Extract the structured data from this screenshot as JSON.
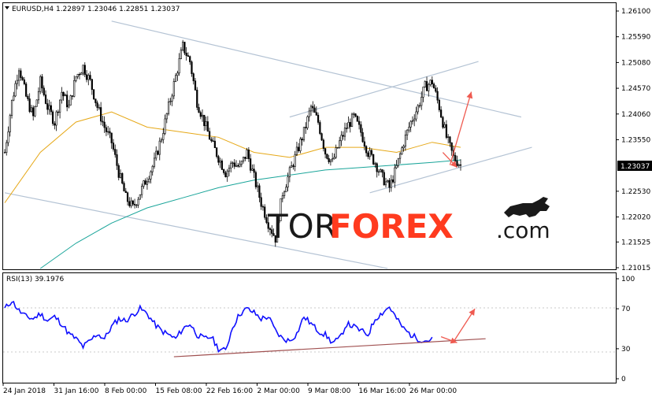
{
  "chart_data": [
    {
      "type": "candlestick",
      "header": "EURUSD,H4  1.22897 1.23046 1.22851 1.23037",
      "symbol": "EURUSD",
      "timeframe": "H4",
      "ylim": [
        1.21015,
        1.261
      ],
      "y_ticks": [
        "1.26100",
        "1.25590",
        "1.25080",
        "1.24570",
        "1.24060",
        "1.23550",
        "1.22530",
        "1.22020",
        "1.21525",
        "1.21015"
      ],
      "last_price": "1.23037",
      "x_ticks": [
        "24 Jan 2018",
        "31 Jan 16:00",
        "8 Feb 00:00",
        "15 Feb 08:00",
        "22 Feb 16:00",
        "2 Mar 00:00",
        "9 Mar 08:00",
        "16 Mar 16:00",
        "26 Mar 00:00"
      ],
      "close_path": [
        [
          0,
          1.233
        ],
        [
          4,
          1.243
        ],
        [
          8,
          1.25
        ],
        [
          12,
          1.244
        ],
        [
          16,
          1.24
        ],
        [
          20,
          1.247
        ],
        [
          24,
          1.242
        ],
        [
          28,
          1.239
        ],
        [
          32,
          1.245
        ],
        [
          36,
          1.242
        ],
        [
          40,
          1.248
        ],
        [
          44,
          1.25
        ],
        [
          48,
          1.247
        ],
        [
          52,
          1.242
        ],
        [
          56,
          1.238
        ],
        [
          60,
          1.235
        ],
        [
          64,
          1.229
        ],
        [
          68,
          1.224
        ],
        [
          72,
          1.222
        ],
        [
          76,
          1.225
        ],
        [
          80,
          1.228
        ],
        [
          84,
          1.231
        ],
        [
          88,
          1.236
        ],
        [
          92,
          1.242
        ],
        [
          96,
          1.248
        ],
        [
          100,
          1.254
        ],
        [
          104,
          1.251
        ],
        [
          108,
          1.243
        ],
        [
          112,
          1.239
        ],
        [
          116,
          1.235
        ],
        [
          120,
          1.232
        ],
        [
          124,
          1.229
        ],
        [
          128,
          1.231
        ],
        [
          132,
          1.23
        ],
        [
          136,
          1.233
        ],
        [
          140,
          1.228
        ],
        [
          144,
          1.223
        ],
        [
          148,
          1.219
        ],
        [
          152,
          1.216
        ],
        [
          156,
          1.225
        ],
        [
          160,
          1.229
        ],
        [
          164,
          1.233
        ],
        [
          168,
          1.237
        ],
        [
          172,
          1.242
        ],
        [
          176,
          1.239
        ],
        [
          180,
          1.233
        ],
        [
          184,
          1.231
        ],
        [
          188,
          1.235
        ],
        [
          192,
          1.238
        ],
        [
          196,
          1.24
        ],
        [
          200,
          1.237
        ],
        [
          204,
          1.233
        ],
        [
          208,
          1.231
        ],
        [
          212,
          1.228
        ],
        [
          216,
          1.226
        ],
        [
          220,
          1.23
        ],
        [
          224,
          1.235
        ],
        [
          228,
          1.239
        ],
        [
          232,
          1.242
        ],
        [
          236,
          1.246
        ],
        [
          240,
          1.247
        ],
        [
          244,
          1.242
        ],
        [
          248,
          1.236
        ],
        [
          252,
          1.232
        ],
        [
          256,
          1.2305
        ]
      ],
      "ma_fast_path": [
        [
          0,
          1.223
        ],
        [
          20,
          1.233
        ],
        [
          40,
          1.239
        ],
        [
          60,
          1.241
        ],
        [
          80,
          1.238
        ],
        [
          100,
          1.237
        ],
        [
          120,
          1.236
        ],
        [
          140,
          1.233
        ],
        [
          160,
          1.232
        ],
        [
          180,
          1.234
        ],
        [
          200,
          1.234
        ],
        [
          220,
          1.233
        ],
        [
          240,
          1.235
        ],
        [
          256,
          1.234
        ]
      ],
      "ma_slow_path": [
        [
          20,
          1.21
        ],
        [
          40,
          1.215
        ],
        [
          60,
          1.219
        ],
        [
          80,
          1.222
        ],
        [
          100,
          1.224
        ],
        [
          120,
          1.226
        ],
        [
          140,
          1.2275
        ],
        [
          160,
          1.2285
        ],
        [
          180,
          1.2295
        ],
        [
          200,
          1.23
        ],
        [
          220,
          1.2305
        ],
        [
          240,
          1.231
        ],
        [
          256,
          1.2315
        ]
      ],
      "channel_lines": [
        {
          "from": [
            60,
            1.259
          ],
          "to": [
            290,
            1.24
          ]
        },
        {
          "from": [
            0,
            1.225
          ],
          "to": [
            215,
            1.21
          ]
        },
        {
          "from": [
            160,
            1.24
          ],
          "to": [
            266,
            1.251
          ]
        },
        {
          "from": [
            205,
            1.225
          ],
          "to": [
            296,
            1.234
          ]
        }
      ],
      "forecast_arrow": {
        "from": [
          250,
          1.2305
        ],
        "to": [
          262,
          1.245
        ]
      },
      "touch_arrow": {
        "from": [
          246,
          1.233
        ],
        "to": [
          254,
          1.23
        ]
      },
      "colors": {
        "candles": "#000000",
        "ma_fast": "#e6a817",
        "ma_slow": "#1aa59a",
        "channel": "#b4c3d4",
        "arrow": "#ef5a50",
        "price_box": "#000000"
      }
    },
    {
      "type": "line",
      "header": "RSI(13) 39.1976",
      "indicator": "RSI(13)",
      "current_value": "39.1976",
      "ylim": [
        0,
        100
      ],
      "y_ticks": [
        "100",
        "70",
        "30",
        "0"
      ],
      "values": [
        [
          0,
          70
        ],
        [
          4,
          78
        ],
        [
          8,
          68
        ],
        [
          12,
          62
        ],
        [
          16,
          60
        ],
        [
          20,
          65
        ],
        [
          24,
          58
        ],
        [
          28,
          62
        ],
        [
          32,
          55
        ],
        [
          36,
          45
        ],
        [
          40,
          40
        ],
        [
          44,
          32
        ],
        [
          48,
          38
        ],
        [
          52,
          45
        ],
        [
          56,
          40
        ],
        [
          60,
          52
        ],
        [
          64,
          60
        ],
        [
          68,
          58
        ],
        [
          72,
          64
        ],
        [
          76,
          70
        ],
        [
          80,
          65
        ],
        [
          84,
          55
        ],
        [
          88,
          48
        ],
        [
          92,
          44
        ],
        [
          96,
          40
        ],
        [
          100,
          50
        ],
        [
          104,
          55
        ],
        [
          108,
          44
        ],
        [
          112,
          40
        ],
        [
          116,
          42
        ],
        [
          120,
          30
        ],
        [
          124,
          28
        ],
        [
          128,
          52
        ],
        [
          132,
          65
        ],
        [
          136,
          70
        ],
        [
          140,
          66
        ],
        [
          144,
          60
        ],
        [
          148,
          62
        ],
        [
          152,
          48
        ],
        [
          156,
          40
        ],
        [
          160,
          38
        ],
        [
          164,
          45
        ],
        [
          168,
          62
        ],
        [
          172,
          55
        ],
        [
          176,
          48
        ],
        [
          180,
          44
        ],
        [
          184,
          36
        ],
        [
          188,
          40
        ],
        [
          192,
          55
        ],
        [
          196,
          52
        ],
        [
          200,
          48
        ],
        [
          204,
          44
        ],
        [
          208,
          60
        ],
        [
          212,
          66
        ],
        [
          216,
          72
        ],
        [
          220,
          60
        ],
        [
          224,
          50
        ],
        [
          228,
          44
        ],
        [
          232,
          40
        ],
        [
          236,
          38
        ],
        [
          240,
          39.2
        ]
      ],
      "trend_line": {
        "from": [
          95,
          22
        ],
        "to": [
          270,
          40
        ]
      },
      "forecast_arrow": {
        "from": [
          252,
          37
        ],
        "to": [
          264,
          70
        ]
      },
      "touch_arrow": {
        "from": [
          245,
          42
        ],
        "to": [
          254,
          36
        ]
      },
      "colors": {
        "line": "#1010ff",
        "trend": "#a05050",
        "arrow": "#ef5a50"
      }
    }
  ],
  "branding": {
    "part1": "TOR",
    "part2": "FOREX",
    "part3": ".com"
  }
}
